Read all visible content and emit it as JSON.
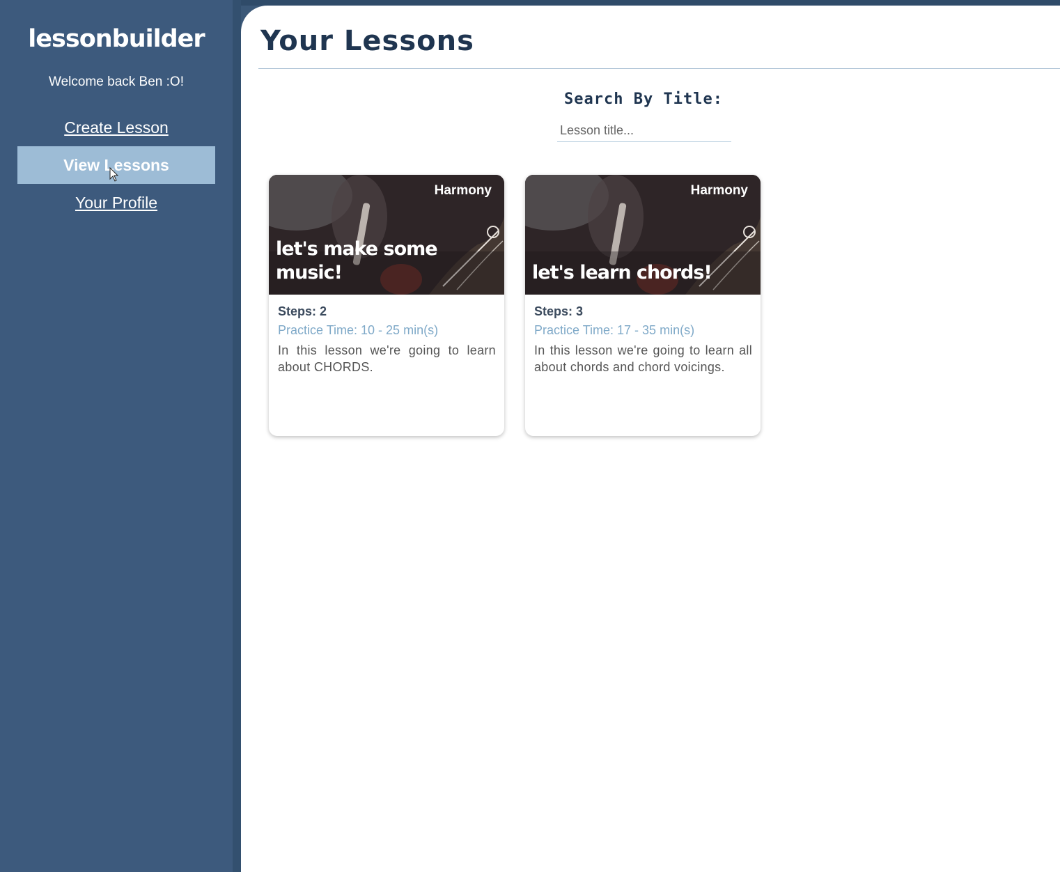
{
  "app": {
    "logo_text": "LessonBuilder",
    "welcome_text": "Welcome back Ben :O!"
  },
  "sidebar": {
    "items": [
      {
        "label": "Create Lesson",
        "active": false
      },
      {
        "label": "View Lessons",
        "active": true
      },
      {
        "label": "Your Profile",
        "active": false
      }
    ]
  },
  "main": {
    "title": "Your Lessons",
    "search": {
      "label": "Search By Title:",
      "placeholder": "Lesson title...",
      "value": ""
    },
    "lessons": [
      {
        "category": "Harmony",
        "title": "Let's make some music!",
        "steps": "Steps: 2",
        "practice_time": "Practice Time: 10 - 25 min(s)",
        "description": "In this lesson we're going to learn about CHORDS."
      },
      {
        "category": "Harmony",
        "title": "Let's learn chords!",
        "steps": "Steps: 3",
        "practice_time": "Practice Time: 17 - 35 min(s)",
        "description": "In this lesson we're going to learn all about chords and chord voicings."
      }
    ]
  },
  "colors": {
    "sidebar": "#3d5a7d",
    "active_nav": "#9dbcd6",
    "title": "#1f3550",
    "practice_time": "#7fa9c8"
  }
}
